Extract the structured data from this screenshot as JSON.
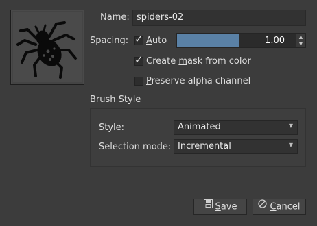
{
  "brush": {
    "name_label": "Name:",
    "name_value": "spiders-02",
    "spacing_label": "Spacing:",
    "auto_label_pre": "",
    "auto_label_mnemonic": "A",
    "auto_label_post": "uto",
    "auto_checked": true,
    "spacing_value": "1.00",
    "spacing_fraction": 0.48,
    "create_mask_pre": "Create ",
    "create_mask_mnemonic": "m",
    "create_mask_post": "ask from color",
    "create_mask_checked": true,
    "preserve_alpha_pre": "",
    "preserve_alpha_mnemonic": "P",
    "preserve_alpha_post": "reserve alpha channel",
    "preserve_alpha_checked": false
  },
  "brush_style": {
    "title": "Brush Style",
    "style_label": "Style:",
    "style_value": "Animated",
    "selection_label": "Selection mode:",
    "selection_value": "Incremental"
  },
  "buttons": {
    "save_mnemonic": "S",
    "save_post": "ave",
    "cancel_mnemonic": "C",
    "cancel_post": "ancel"
  },
  "icons": {
    "preview": "spider-brush-preview",
    "save": "save-icon",
    "cancel": "cancel-icon"
  },
  "colors": {
    "background": "#3c3c3c",
    "spin_fill": "#5a81a6",
    "field_bg": "#323232"
  }
}
